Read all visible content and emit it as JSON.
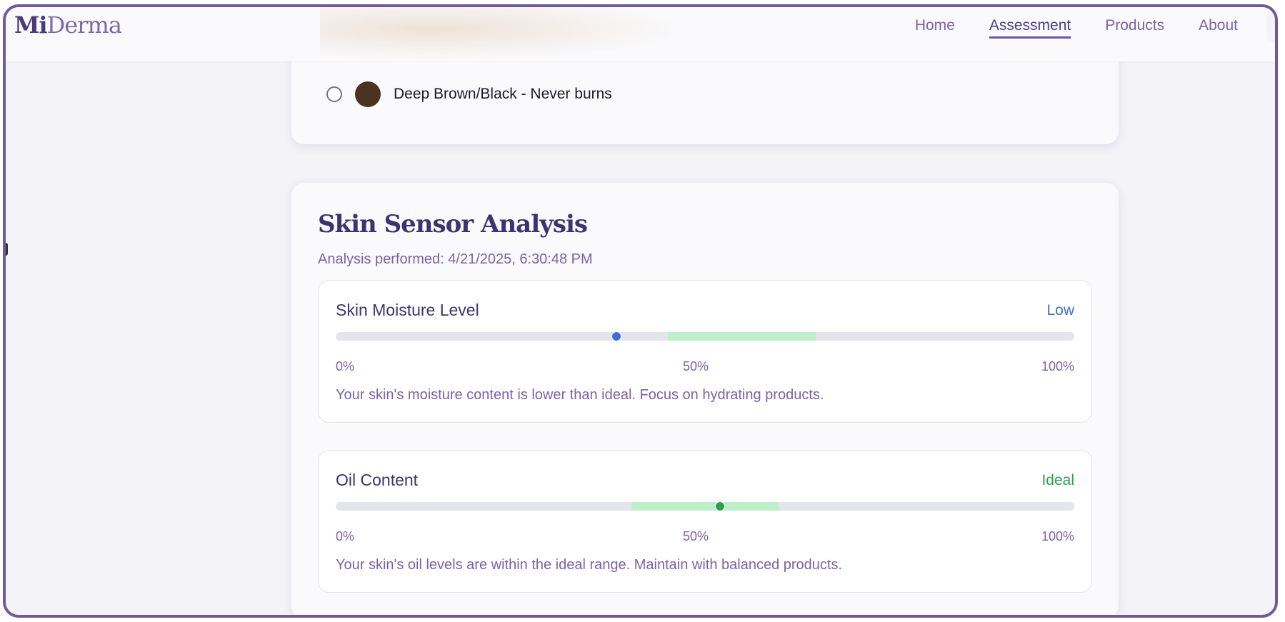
{
  "app": {
    "logo_mi": "Mi",
    "logo_rest": "Derma"
  },
  "nav": {
    "items": [
      {
        "label": "Home",
        "active": false
      },
      {
        "label": "Assessment",
        "active": true
      },
      {
        "label": "Products",
        "active": false
      },
      {
        "label": "About",
        "active": false
      }
    ]
  },
  "skin_type_option": {
    "label": "Deep Brown/Black - Never burns",
    "selected": false,
    "swatch_color": "#4a3420"
  },
  "analysis": {
    "title": "Skin Sensor Analysis",
    "performed": "Analysis performed: 4/21/2025, 6:30:48 PM",
    "metrics": [
      {
        "name": "Skin Moisture Level",
        "status": "Low",
        "status_color": "#3b6fd8",
        "value_percent": 38,
        "ideal_range_percent": [
          45,
          65
        ],
        "ticks": [
          "0%",
          "50%",
          "100%"
        ],
        "description": "Your skin's moisture content is lower than ideal. Focus on hydrating products."
      },
      {
        "name": "Oil Content",
        "status": "Ideal",
        "status_color": "#2aa04f",
        "value_percent": 52,
        "ideal_range_percent": [
          40,
          60
        ],
        "ticks": [
          "0%",
          "50%",
          "100%"
        ],
        "description": "Your skin's oil levels are within the ideal range. Maintain with balanced products."
      }
    ]
  },
  "colors": {
    "frame": "#6e5a9e",
    "accent": "#6a54a8",
    "ideal_band": "#bdf0c9",
    "track": "#e3e5ea"
  }
}
